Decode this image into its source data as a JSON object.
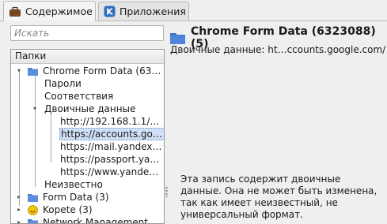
{
  "tabs": [
    {
      "label": "Содержимое",
      "active": true,
      "icon": "briefcase-icon"
    },
    {
      "label": "Приложения",
      "active": false,
      "icon": "kde-apps-icon"
    }
  ],
  "search": {
    "placeholder": "Искать",
    "value": ""
  },
  "tree": {
    "header": "Папки",
    "items": [
      {
        "label": "Chrome Form Data (63…",
        "level": 1,
        "folder": true,
        "expanded": true
      },
      {
        "label": "Пароли",
        "level": 2
      },
      {
        "label": "Соответствия",
        "level": 2
      },
      {
        "label": "Двоичные данные",
        "level": 2,
        "expanded": true
      },
      {
        "label": "http://192.168.1.1/…",
        "level": 3
      },
      {
        "label": "https://accounts.go…",
        "level": 3,
        "selected": true
      },
      {
        "label": "https://mail.yandex…",
        "level": 3
      },
      {
        "label": "https://passport.ya…",
        "level": 3
      },
      {
        "label": "https://www.yande…",
        "level": 3
      },
      {
        "label": "Неизвестно",
        "level": 2
      },
      {
        "label": "Form Data (3)",
        "level": 1,
        "folder": true,
        "expanded": false
      },
      {
        "label": "Kopete (3)",
        "level": 1,
        "icon": "kopete-icon",
        "expanded": false
      },
      {
        "label": "Network Management …",
        "level": 1,
        "folder": true,
        "expanded": false
      }
    ]
  },
  "detail": {
    "title": "Chrome Form Data (6323088) (5)",
    "subtitle": "Двоичные данные: ht…ccounts.google.com/",
    "note": "Эта запись содержит двоичные данные. Она не может быть изменена, так как имеет неизвестный, не универсальный формат."
  },
  "colors": {
    "folder": "#4a7fd0",
    "selection": "#cfe0f7",
    "kopete": "#f2c300"
  }
}
